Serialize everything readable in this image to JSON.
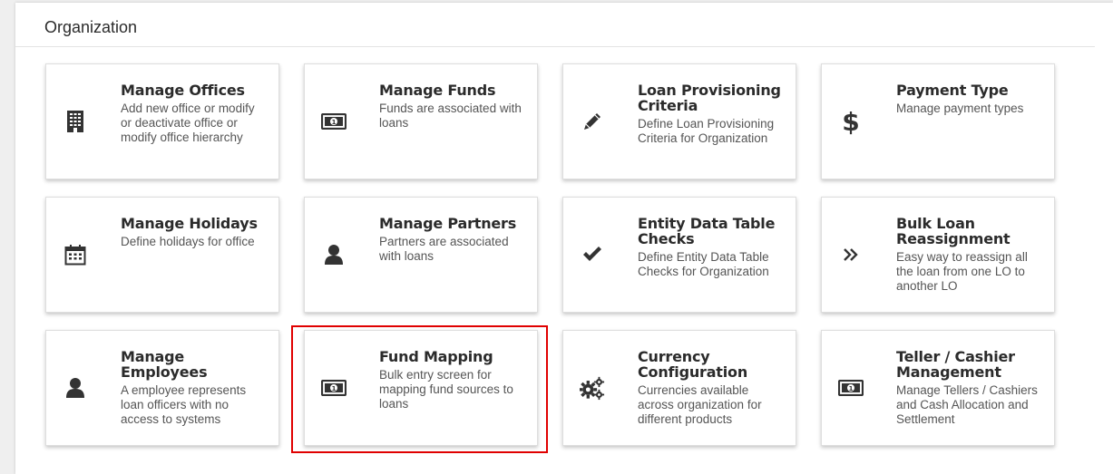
{
  "section": {
    "title": "Organization"
  },
  "colors": {
    "highlight": "#e00000",
    "icon": "#333333"
  },
  "cards": [
    {
      "title": "Manage Offices",
      "desc": "Add new office or modify or deactivate office or modify office hierarchy",
      "icon": "building-icon"
    },
    {
      "title": "Manage Funds",
      "desc": "Funds are associated with loans",
      "icon": "money-icon"
    },
    {
      "title": "Loan Provisioning Criteria",
      "desc": "Define Loan Provisioning Criteria for Organization",
      "icon": "pencil-icon"
    },
    {
      "title": "Payment Type",
      "desc": "Manage payment types",
      "icon": "dollar-icon"
    },
    {
      "title": "Manage Holidays",
      "desc": "Define holidays for office",
      "icon": "calendar-icon"
    },
    {
      "title": "Manage Partners",
      "desc": "Partners are associated with loans",
      "icon": "user-icon"
    },
    {
      "title": "Entity Data Table Checks",
      "desc": "Define Entity Data Table Checks for Organization",
      "icon": "check-icon"
    },
    {
      "title": "Bulk Loan Reassignment",
      "desc": "Easy way to reassign all the loan from one LO to another LO",
      "icon": "double-chevron-right-icon"
    },
    {
      "title": "Manage Employees",
      "desc": "A employee represents loan officers with no access to systems",
      "icon": "user-icon"
    },
    {
      "title": "Fund Mapping",
      "desc": "Bulk entry screen for mapping fund sources to loans",
      "icon": "money-icon"
    },
    {
      "title": "Currency Configuration",
      "desc": "Currencies available across organization for different products",
      "icon": "gears-icon"
    },
    {
      "title": "Teller / Cashier Management",
      "desc": "Manage Tellers / Cashiers and Cash Allocation and Settlement",
      "icon": "money-icon"
    }
  ]
}
